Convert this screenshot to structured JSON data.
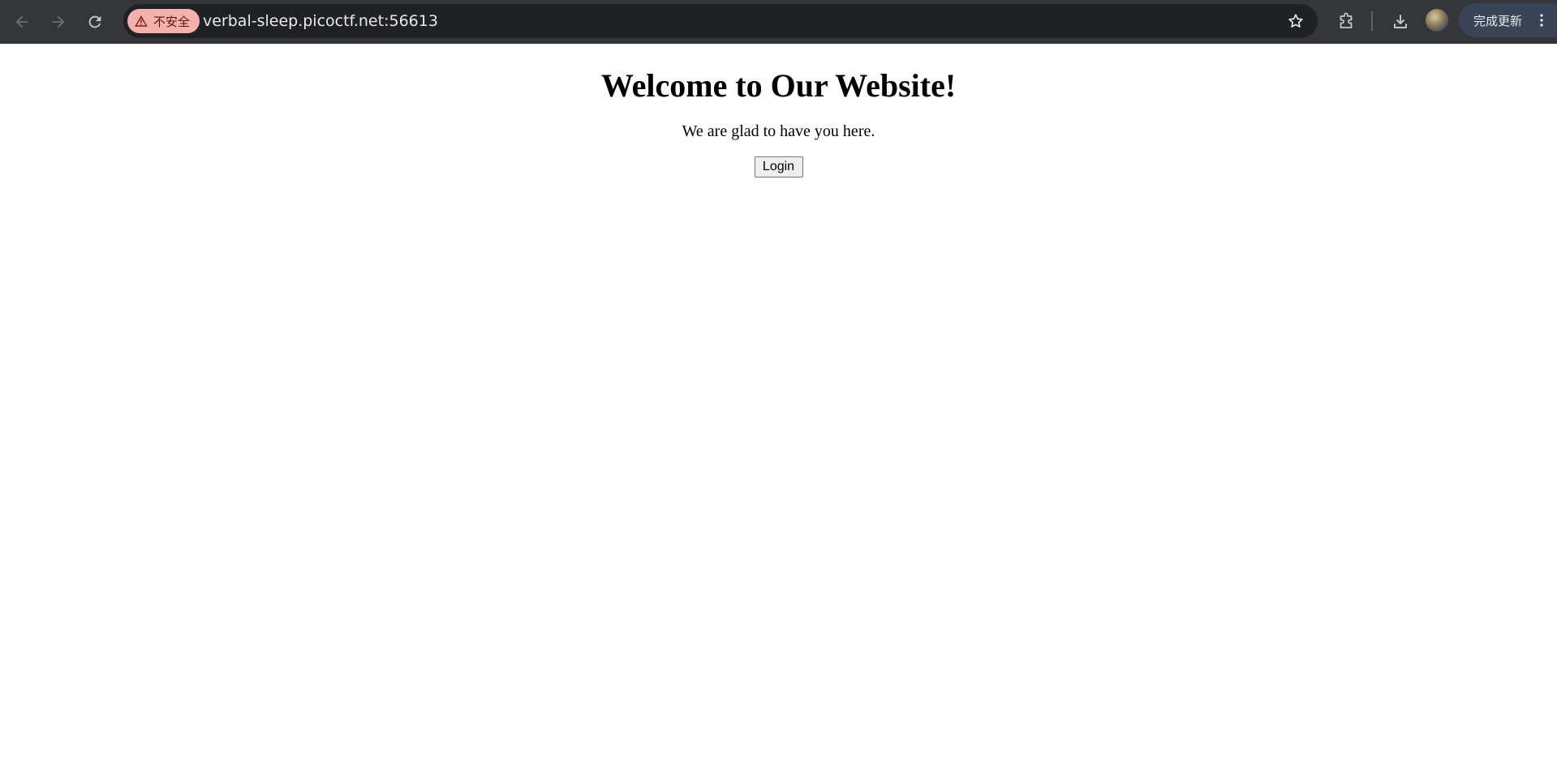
{
  "browser": {
    "security_label": "不安全",
    "url": "verbal-sleep.picoctf.net:56613",
    "update_label": "完成更新",
    "icons": {
      "back": "back-arrow-icon",
      "forward": "forward-arrow-icon",
      "reload": "reload-icon",
      "warning": "warning-triangle-icon",
      "bookmark": "star-icon",
      "extensions": "puzzle-piece-icon",
      "downloads": "download-icon",
      "profile": "avatar",
      "menu": "kebab-menu-icon"
    },
    "colors": {
      "toolbar": "#35363a",
      "omnibox": "#202124",
      "security_chip": "#f4b0ac",
      "update_chip": "#394457"
    }
  },
  "page": {
    "heading": "Welcome to Our Website!",
    "subtitle": "We are glad to have you here.",
    "login_label": "Login"
  }
}
